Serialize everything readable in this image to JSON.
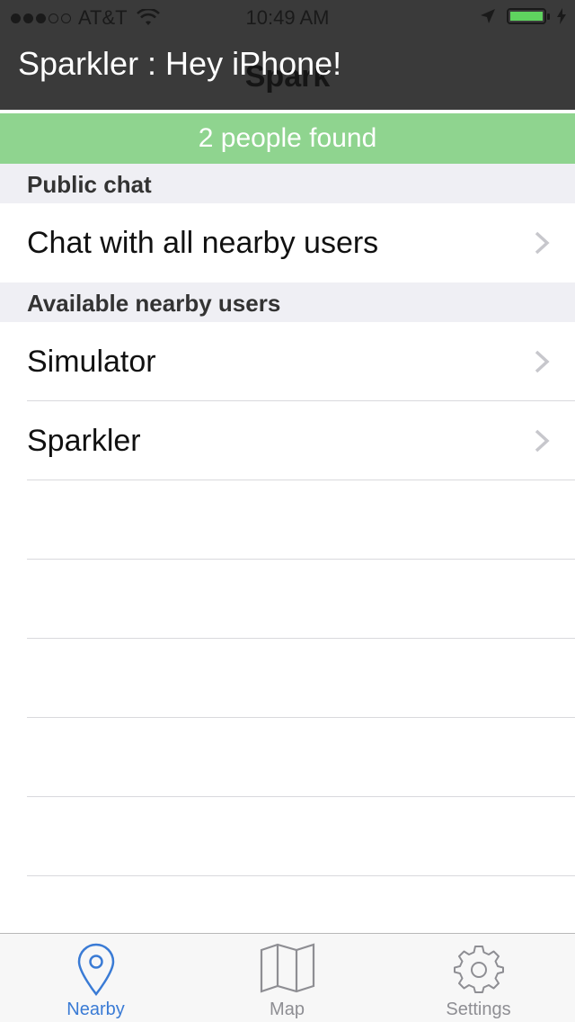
{
  "status": {
    "carrier": "AT&T",
    "time": "10:49 AM",
    "signal_dots_filled": 3,
    "signal_dots_total": 5,
    "battery_level": 1.0
  },
  "nav": {
    "title": "Spark"
  },
  "banner": {
    "text": "Sparkler : Hey iPhone!"
  },
  "found_bar": {
    "text": "2 people found"
  },
  "sections": {
    "public": {
      "header": "Public chat",
      "rows": [
        {
          "label": "Chat with all nearby users"
        }
      ]
    },
    "nearby": {
      "header": "Available nearby users",
      "rows": [
        {
          "label": "Simulator"
        },
        {
          "label": "Sparkler"
        }
      ]
    }
  },
  "tabs": [
    {
      "label": "Nearby",
      "icon": "location-pin-icon",
      "active": true
    },
    {
      "label": "Map",
      "icon": "map-icon",
      "active": false
    },
    {
      "label": "Settings",
      "icon": "gear-icon",
      "active": false
    }
  ],
  "colors": {
    "banner_bg": "#3a3a3a",
    "found_bar_bg": "#8fd48f",
    "active_tab": "#3a7bd5",
    "inactive_tab": "#8e8e93"
  }
}
